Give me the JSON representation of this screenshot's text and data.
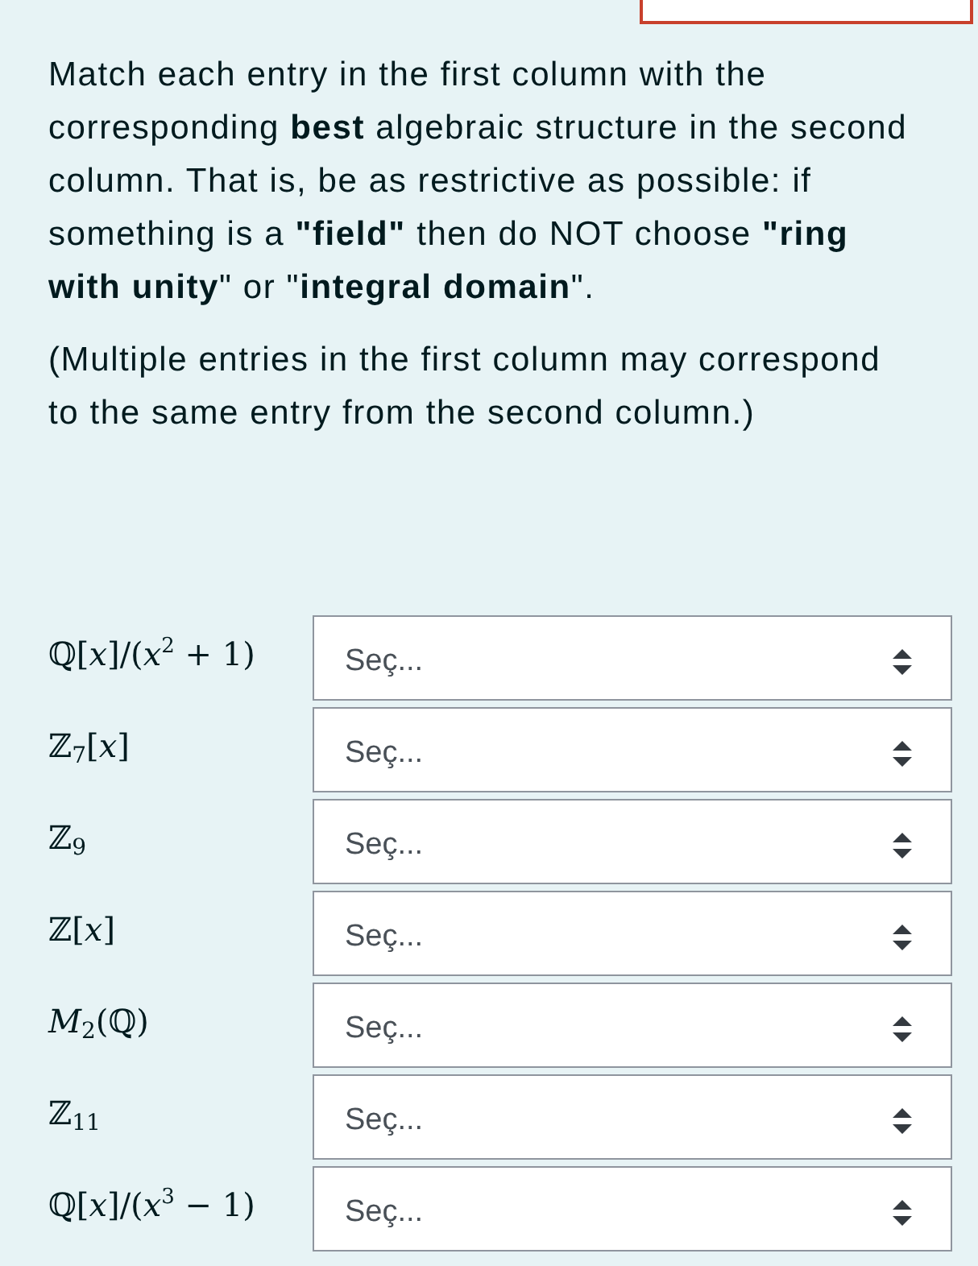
{
  "instructions": [
    "Match each entry in the first column with the corresponding **best** algebraic structure in the second column. That is, be as restrictive as possible: if something is a **\"field\"** then do NOT choose **\"ring with unity**\" or \"**integral domain**\".",
    "(Multiple entries in the first column may correspond to the same entry from the second column.)"
  ],
  "matches": [
    {
      "term": "ℚ[*x*]/(*x*$^{2}$ + 1)",
      "choice": "Seç..."
    },
    {
      "term": "ℤ$_{7}$[*x*]",
      "choice": "Seç..."
    },
    {
      "term": "ℤ$_{9}$",
      "choice": "Seç..."
    },
    {
      "term": "ℤ[*x*]",
      "choice": "Seç..."
    },
    {
      "term": "*M*$_{2}$(ℚ)",
      "choice": "Seç..."
    },
    {
      "term": "ℤ$_{11}$",
      "choice": "Seç..."
    },
    {
      "term": "ℚ[*x*]/(*x*$^{3}$ − 1)",
      "choice": "Seç..."
    }
  ]
}
